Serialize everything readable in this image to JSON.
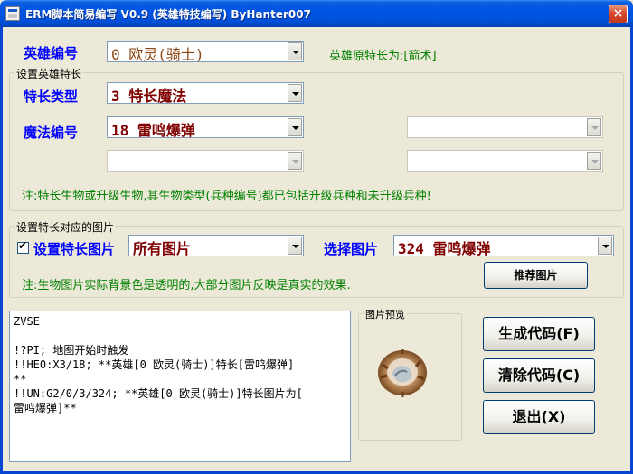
{
  "window": {
    "title": "ERM脚本简易编写 V0.9 (英雄特技编写) ByHanter007",
    "close_label": "×"
  },
  "hero": {
    "label": "英雄编号",
    "value": "0 欧灵(骑士)",
    "original_specialty": "英雄原特长为:[箭术]"
  },
  "specialty_group": {
    "title": "设置英雄特长",
    "type_label": "特长类型",
    "type_value": "3 特长魔法",
    "spell_label": "魔法编号",
    "spell_value": "18 雷鸣爆弹",
    "note": "注:特长生物或升级生物,其生物类型(兵种编号)都已包括升级兵种和未升级兵种!"
  },
  "picture_group": {
    "title": "设置特长对应的图片",
    "checkbox_mark": "✔",
    "checkbox_label": "设置特长图片",
    "picture_filter_value": "所有图片",
    "select_label": "选择图片",
    "select_value": "324 雷鸣爆弹",
    "note": "注:生物图片实际背景色是透明的,大部分图片反映是真实的效果.",
    "recommend_button": "推荐图片"
  },
  "code": {
    "text": "ZVSE\n\n!?PI; 地图开始时触发\n!!HE0:X3/18; **英雄[0 欧灵(骑士)]特长[雷鸣爆弹]\n**\n!!UN:G2/0/3/324; **英雄[0 欧灵(骑士)]特长图片为[\n雷鸣爆弹]**"
  },
  "preview": {
    "title": "图片预览"
  },
  "buttons": {
    "generate": "生成代码(F)",
    "clear": "清除代码(C)",
    "exit": "退出(X)"
  },
  "colors": {
    "title_bar": "#0054E3",
    "label_blue": "#0000FF",
    "note_green": "#008000",
    "hero_value": "#8B4513",
    "field_value_red": "#800000"
  }
}
